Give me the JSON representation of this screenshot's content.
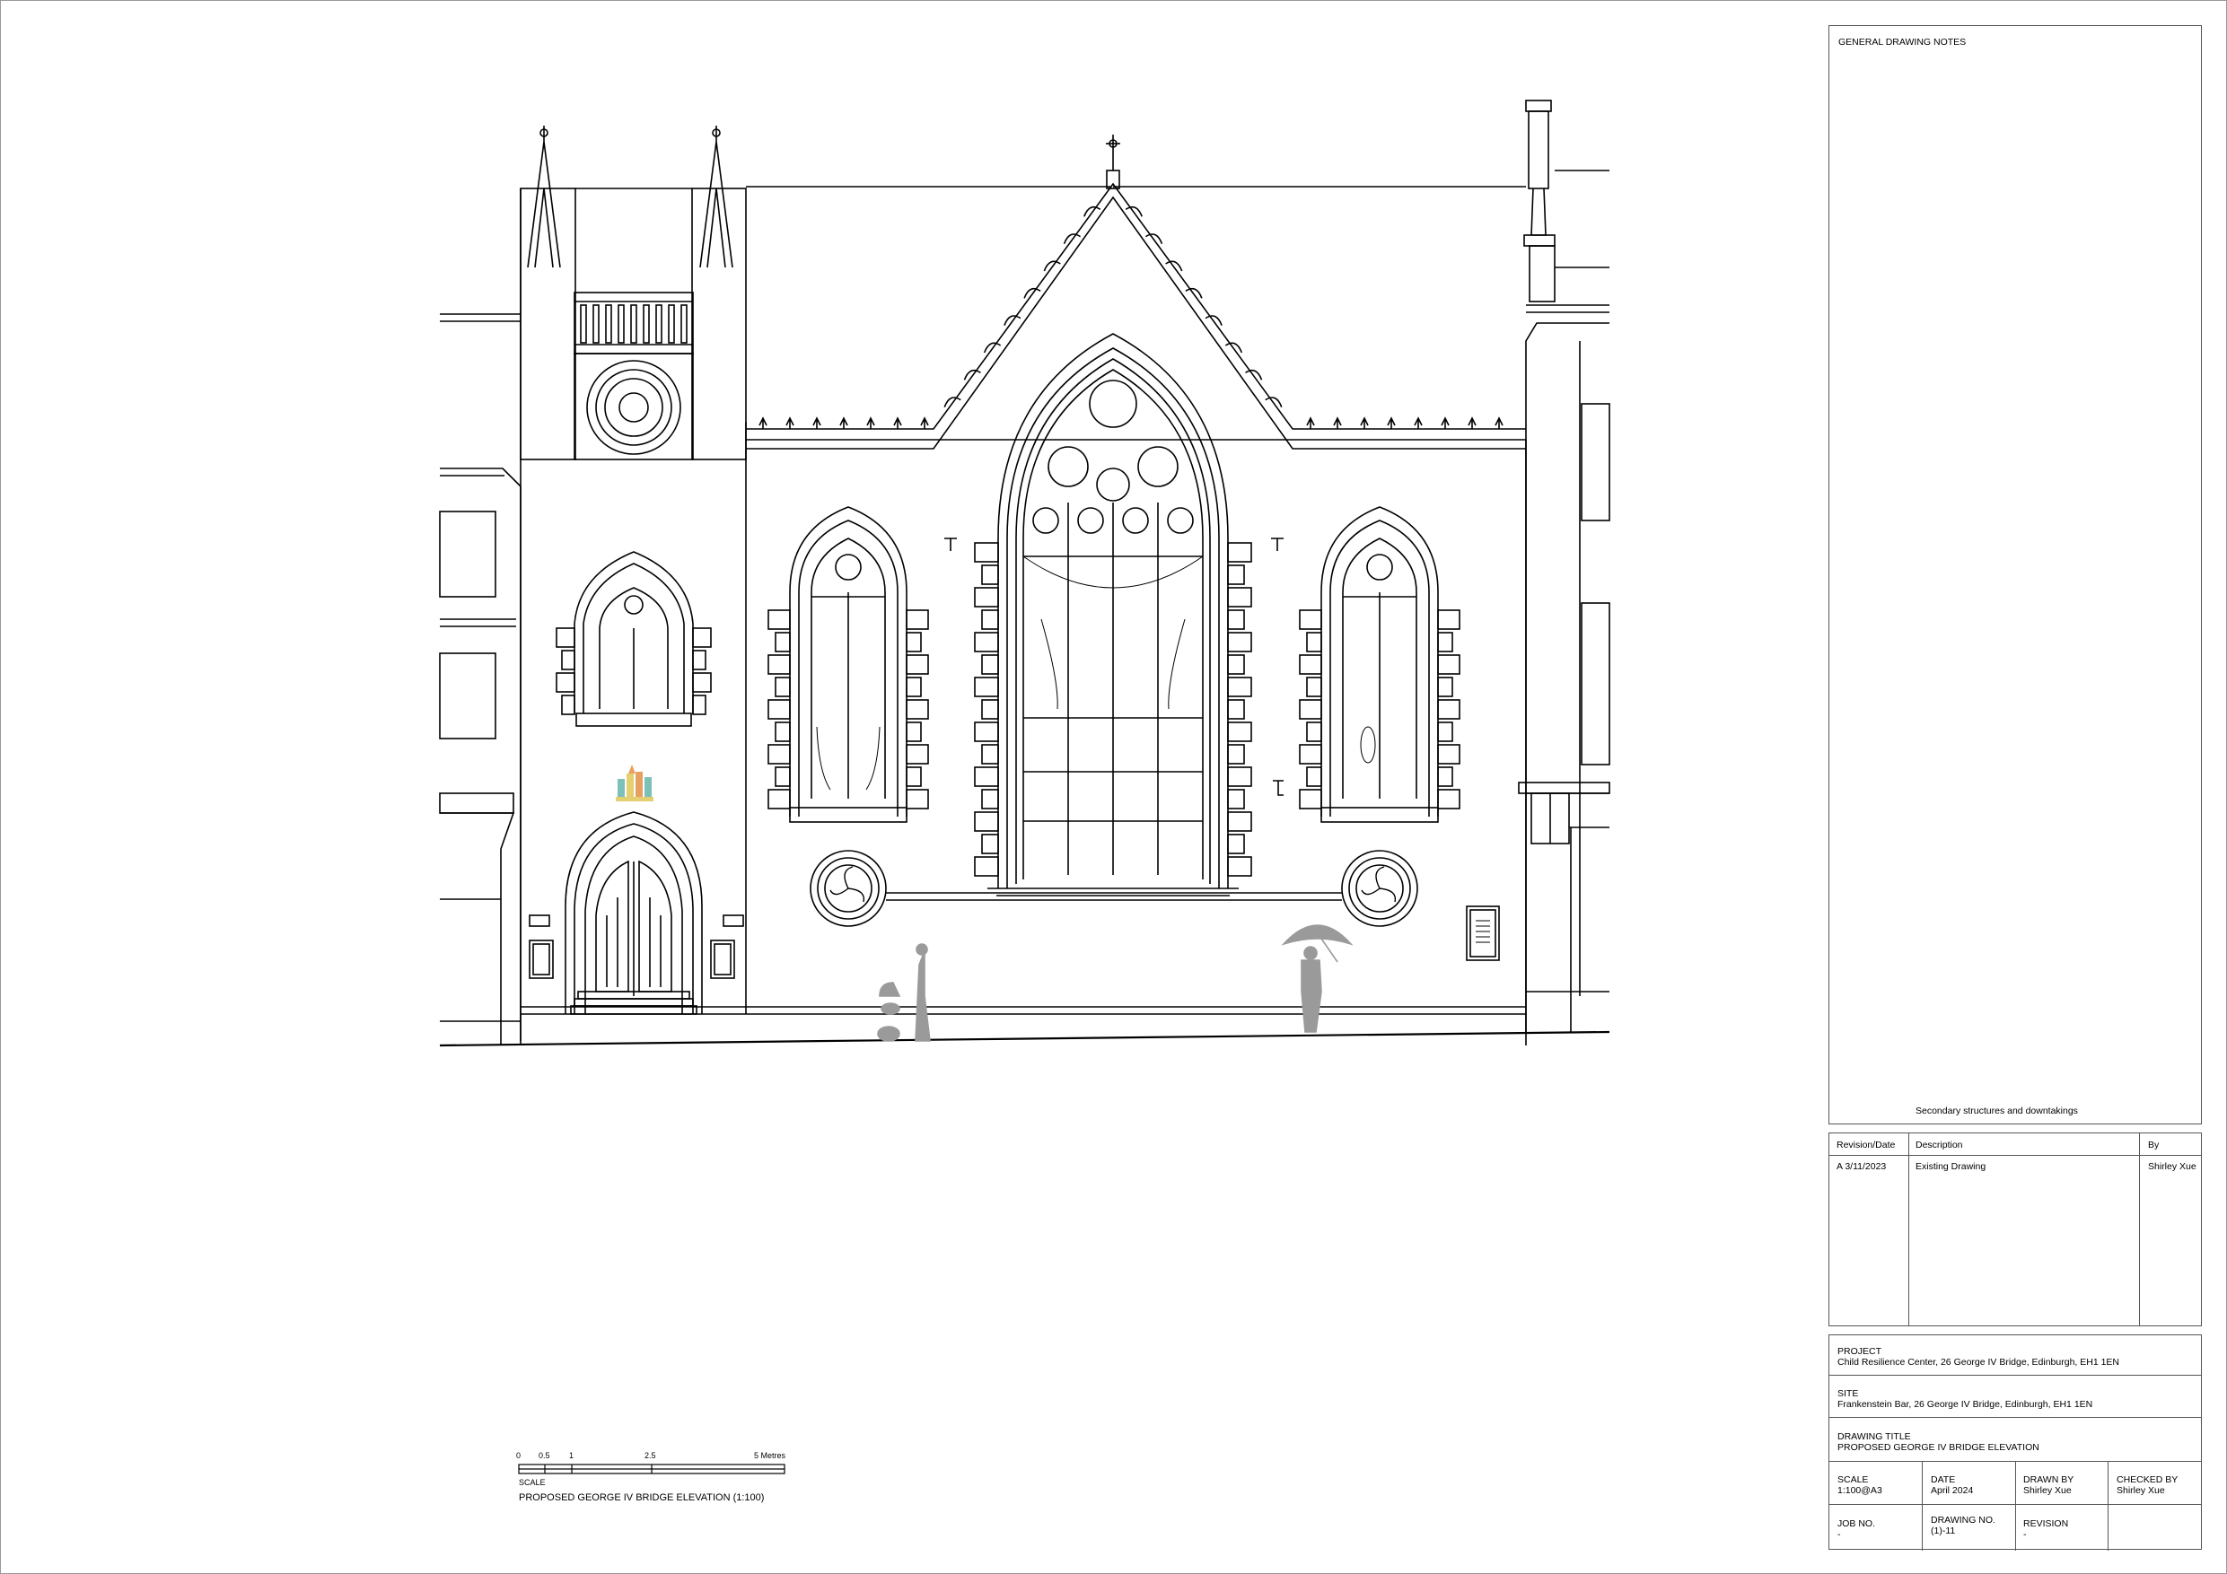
{
  "notes": {
    "heading": "GENERAL DRAWING NOTES",
    "footnote": "Secondary structures and downtakings"
  },
  "revisions": {
    "headers": {
      "date": "Revision/Date",
      "description": "Description",
      "by": "By"
    },
    "rows": [
      {
        "date": "A 3/11/2023",
        "description": "Existing Drawing",
        "by": "Shirley Xue"
      }
    ]
  },
  "project": {
    "label": "PROJECT",
    "value": "Child Resilience Center, 26 George IV Bridge, Edinburgh, EH1 1EN"
  },
  "site": {
    "label": "SITE",
    "value": "Frankenstein Bar, 26 George IV Bridge, Edinburgh, EH1 1EN"
  },
  "drawing_title": {
    "label": "DRAWING TITLE",
    "value": "PROPOSED GEORGE IV BRIDGE ELEVATION"
  },
  "meta": {
    "scale_label": "SCALE",
    "scale_value": "1:100@A3",
    "date_label": "DATE",
    "date_value": "April 2024",
    "drawn_label": "DRAWN BY",
    "drawn_value": "Shirley Xue",
    "checked_label": "CHECKED BY",
    "checked_value": "Shirley Xue",
    "job_label": "JOB NO.",
    "job_value": "-",
    "drawing_no_label": "DRAWING NO.",
    "drawing_no_value": "(1)-11",
    "revision_label": "REVISION",
    "revision_value": "-"
  },
  "scale_bar": {
    "ticks": [
      "0",
      "0.5",
      "1",
      "2.5",
      "5 Metres"
    ],
    "label": "SCALE",
    "caption": "PROPOSED GEORGE IV BRIDGE ELEVATION (1:100)"
  },
  "colors": {
    "line": "#000000",
    "frame": "#555555",
    "figure_grey": "#9a9a9a",
    "sign_orange": "#e8a060",
    "sign_teal": "#7cc0b8",
    "sign_yellow": "#e4d070"
  }
}
